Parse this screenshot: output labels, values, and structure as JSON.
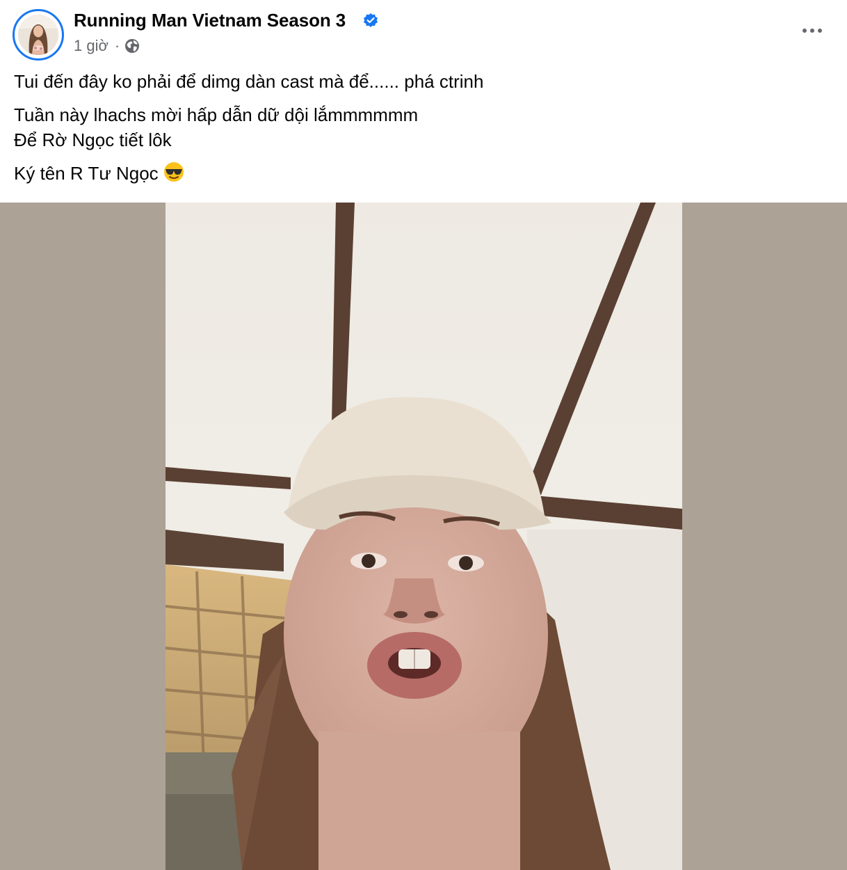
{
  "post": {
    "page_name": "Running Man Vietnam Season 3",
    "verified": true,
    "timestamp": "1 giờ",
    "separator": "·",
    "audience_icon": "globe-icon",
    "more_icon": "more-horizontal-icon"
  },
  "content": {
    "line1": "Tui đến đây ko phải để dimg dàn cast mà để...... phá ctrinh",
    "line2": "Tuần này lhachs mời hấp dẫn dữ dội lắmmmmmm",
    "line3": "Để Rờ Ngọc tiết lôk",
    "line4": "Ký tên R Tư Ngọc",
    "emoji": "smiling-face-with-sunglasses"
  },
  "colors": {
    "accent": "#1877f2",
    "secondary_text": "#65676b",
    "media_background": "#aca295"
  }
}
